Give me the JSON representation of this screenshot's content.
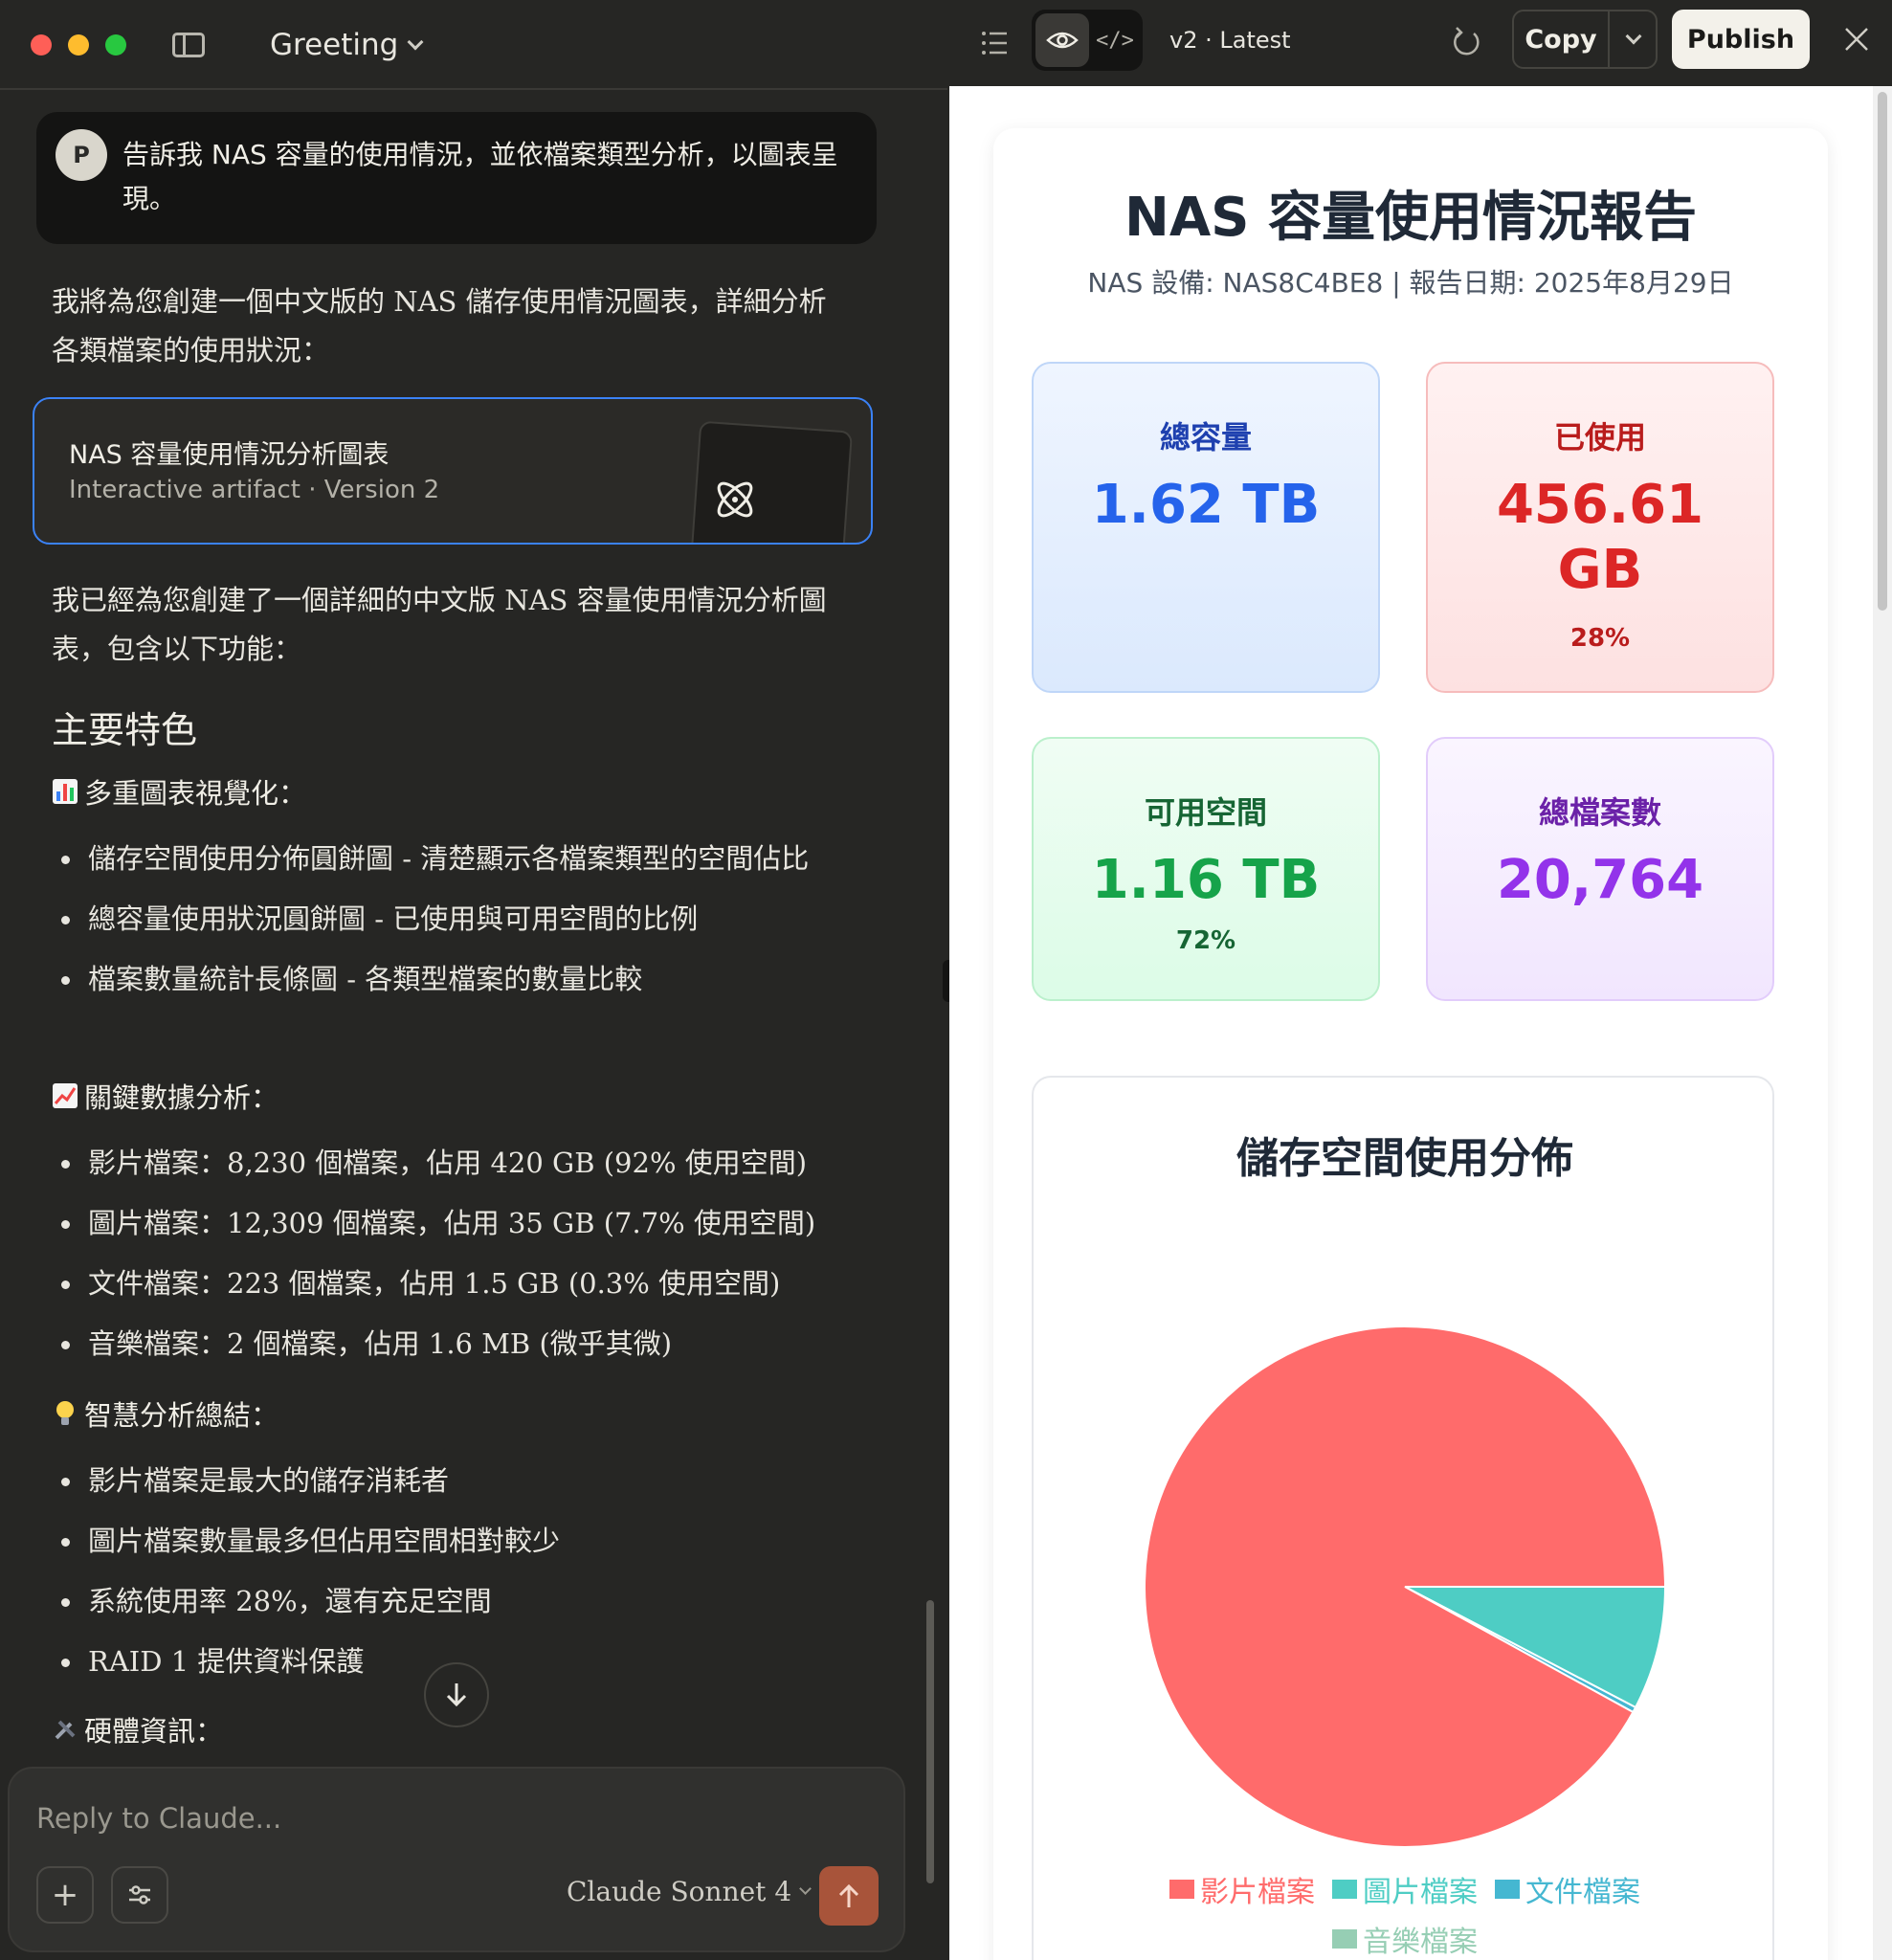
{
  "window": {
    "title": "Greeting"
  },
  "conversation": {
    "user_avatar": "P",
    "user_message": "告訴我 NAS 容量的使用情況，並依檔案類型分析，以圖表呈現。",
    "intro": "我將為您創建一個中文版的 NAS 儲存使用情況圖表，詳細分析各類檔案的使用狀況：",
    "artifact": {
      "title": "NAS 容量使用情況分析圖表",
      "subtitle": "Interactive artifact  ·  Version 2"
    },
    "summary": "我已經為您創建了一個詳細的中文版 NAS 容量使用情況分析圖表，包含以下功能：",
    "features_heading": "主要特色",
    "section1_title": "多重圖表視覺化：",
    "section1_items": [
      "儲存空間使用分佈圓餅圖 - 清楚顯示各檔案類型的空間佔比",
      "總容量使用狀況圓餅圖 - 已使用與可用空間的比例",
      "檔案數量統計長條圖 - 各類型檔案的數量比較"
    ],
    "section2_title": "關鍵數據分析：",
    "section2_items": [
      "影片檔案：8,230 個檔案，佔用 420 GB (92% 使用空間)",
      "圖片檔案：12,309 個檔案，佔用 35 GB (7.7% 使用空間)",
      "文件檔案：223 個檔案，佔用 1.5 GB (0.3% 使用空間)",
      "音樂檔案：2 個檔案，佔用 1.6 MB (微乎其微)"
    ],
    "section3_title": "智慧分析總結：",
    "section3_items": [
      "影片檔案是最大的儲存消耗者",
      "圖片檔案數量最多但佔用空間相對較少",
      "系統使用率 28%，還有充足空間",
      "RAID 1 提供資料保護"
    ],
    "section4_title": "硬體資訊："
  },
  "composer": {
    "placeholder": "Reply to Claude...",
    "model": "Claude Sonnet 4"
  },
  "artifact_panel": {
    "version_label": "v2 · Latest",
    "copy_label": "Copy",
    "publish_label": "Publish"
  },
  "report": {
    "title": "NAS 容量使用情況報告",
    "subtitle": "NAS 設備: NAS8C4BE8 | 報告日期: 2025年8月29日",
    "stats": {
      "total": {
        "label": "總容量",
        "value": "1.62 TB"
      },
      "used": {
        "label": "已使用",
        "value_line1": "456.61",
        "value_line2": "GB",
        "percent": "28%"
      },
      "free": {
        "label": "可用空間",
        "value": "1.16 TB",
        "percent": "72%"
      },
      "files": {
        "label": "總檔案數",
        "value": "20,764"
      }
    }
  },
  "chart_data": {
    "type": "pie",
    "title": "儲存空間使用分佈",
    "categories": [
      "影片檔案",
      "圖片檔案",
      "文件檔案",
      "音樂檔案"
    ],
    "values": [
      420,
      35,
      1.5,
      0.0016
    ],
    "colors": [
      "#ff6b6b",
      "#4ecdc4",
      "#45b7d1",
      "#96ceb4"
    ],
    "legend_position": "bottom"
  }
}
